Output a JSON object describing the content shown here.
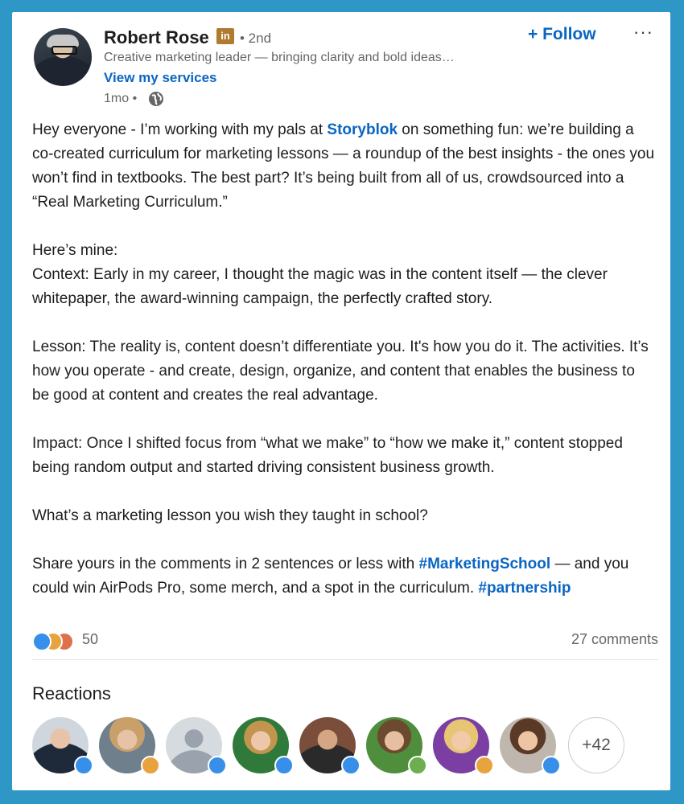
{
  "author": {
    "name": "Robert Rose",
    "badge": "in",
    "degree": "• 2nd",
    "headline": "Creative marketing leader — bringing clarity and bold ideas…",
    "services_link": "View my services",
    "time": "1mo •",
    "globe_icon": "globe-icon"
  },
  "actions": {
    "follow": "+ Follow",
    "more": "···"
  },
  "post": {
    "p1_a": "Hey everyone - I’m working with my pals at ",
    "p1_link": "Storyblok",
    "p1_b": " on something fun: we’re building a co-created curriculum for marketing lessons — a roundup of the best insights - the ones you won’t find in textbooks. The best part? It’s being built from all of us, crowdsourced into a “Real Marketing Curriculum.”",
    "p2_a": "Here’s mine:",
    "p2_b": "Context: Early in my career, I thought the magic was in the content itself — the clever whitepaper, the award-winning campaign, the perfectly crafted story.",
    "p3": "Lesson: The reality is, content doesn’t differentiate you. It's how you do it. The activities. It’s how you operate - and create, design, organize, and content that enables the business to be good at content and creates the real advantage.",
    "p4": "Impact: Once I shifted focus from “what we make” to “how we make it,” content stopped being random output and started driving consistent business growth.",
    "p5": "What’s a marketing lesson you wish they taught in school?",
    "p6_a": "Share yours in the comments in 2 sentences or less with ",
    "p6_link1": "#MarketingSchool",
    "p6_b": " — and you could win AirPods Pro, some merch, and a spot in the curriculum. ",
    "p6_link2": "#partnership"
  },
  "stats": {
    "reaction_count": "50",
    "comments": "27 comments",
    "reaction_icons": [
      "like-icon",
      "insightful-icon",
      "love-icon"
    ]
  },
  "reactions": {
    "title": "Reactions",
    "more": "+42",
    "people": [
      {
        "badge": "like-icon"
      },
      {
        "badge": "insightful-icon"
      },
      {
        "badge": "like-icon"
      },
      {
        "badge": "like-icon"
      },
      {
        "badge": "like-icon"
      },
      {
        "badge": "support-icon"
      },
      {
        "badge": "insightful-icon"
      },
      {
        "badge": "like-icon"
      }
    ]
  },
  "colors": {
    "background": "#2e97c6",
    "link": "#0a66c2",
    "like": "#378fe9",
    "insightful": "#e7a33e",
    "love": "#df704d",
    "support": "#6dae4f"
  }
}
